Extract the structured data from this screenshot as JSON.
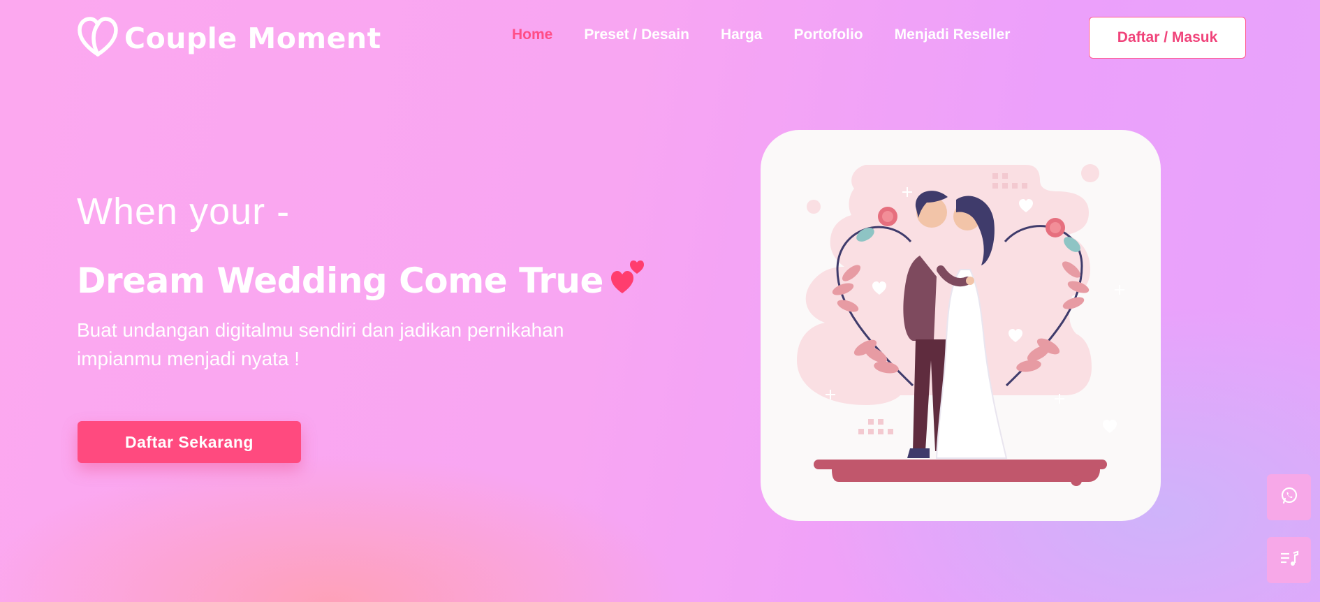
{
  "brand": {
    "name": "Couple Moment",
    "logo_icon": "heart-outline-icon"
  },
  "nav": {
    "items": [
      {
        "label": "Home",
        "active": true
      },
      {
        "label": "Preset / Desain",
        "active": false
      },
      {
        "label": "Harga",
        "active": false
      },
      {
        "label": "Portofolio",
        "active": false
      },
      {
        "label": "Menjadi Reseller",
        "active": false
      }
    ],
    "auth_label": "Daftar / Masuk"
  },
  "hero": {
    "pre_title": "When your -",
    "title": "Dream Wedding Come True",
    "subtitle": "Buat undangan digitalmu sendiri dan jadikan pernikahan impianmu menjadi nyata !",
    "cta_label": "Daftar Sekarang",
    "title_icon": "two-hearts-icon",
    "illustration": "wedding-couple-illustration"
  },
  "floating_buttons": [
    {
      "icon": "whatsapp-icon"
    },
    {
      "icon": "music-playlist-icon"
    }
  ],
  "colors": {
    "accent": "#ff4a7f",
    "active_nav": "#ff4d86",
    "card_bg": "#fbf9f9"
  }
}
